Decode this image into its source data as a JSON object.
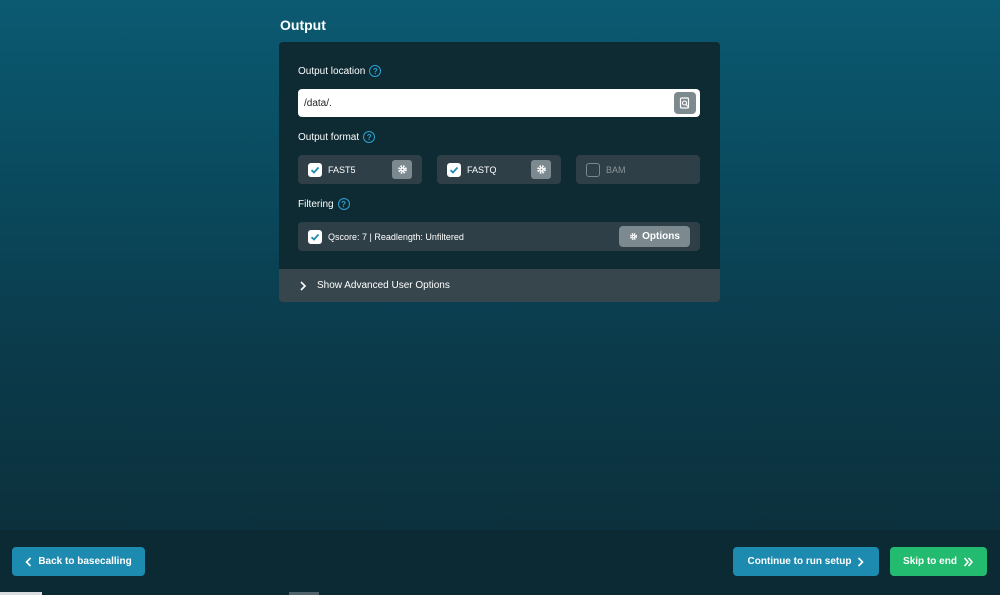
{
  "section": {
    "title": "Output"
  },
  "output_location": {
    "label": "Output location",
    "value": "/data/.",
    "help_icon": "question-circle-icon",
    "browse_icon": "folder-search-icon"
  },
  "output_format": {
    "label": "Output format",
    "help_icon": "question-circle-icon",
    "formats": [
      {
        "label": "FAST5",
        "checked": true,
        "has_settings": true
      },
      {
        "label": "FASTQ",
        "checked": true,
        "has_settings": true
      },
      {
        "label": "BAM",
        "checked": false,
        "has_settings": false
      }
    ]
  },
  "filtering": {
    "label": "Filtering",
    "help_icon": "question-circle-icon",
    "summary": "Qscore: 7 | Readlength: Unfiltered",
    "checked": true,
    "options_label": "Options"
  },
  "advanced": {
    "label": "Show Advanced User Options",
    "icon": "chevron-right-icon"
  },
  "footer": {
    "back_label": "Back to basecalling",
    "continue_label": "Continue to run setup",
    "skip_label": "Skip to end"
  },
  "colors": {
    "primary_button": "#1d8bb0",
    "success_button": "#22bb6f",
    "help_icon": "#2aa3d6",
    "panel": "#0e2a33"
  }
}
